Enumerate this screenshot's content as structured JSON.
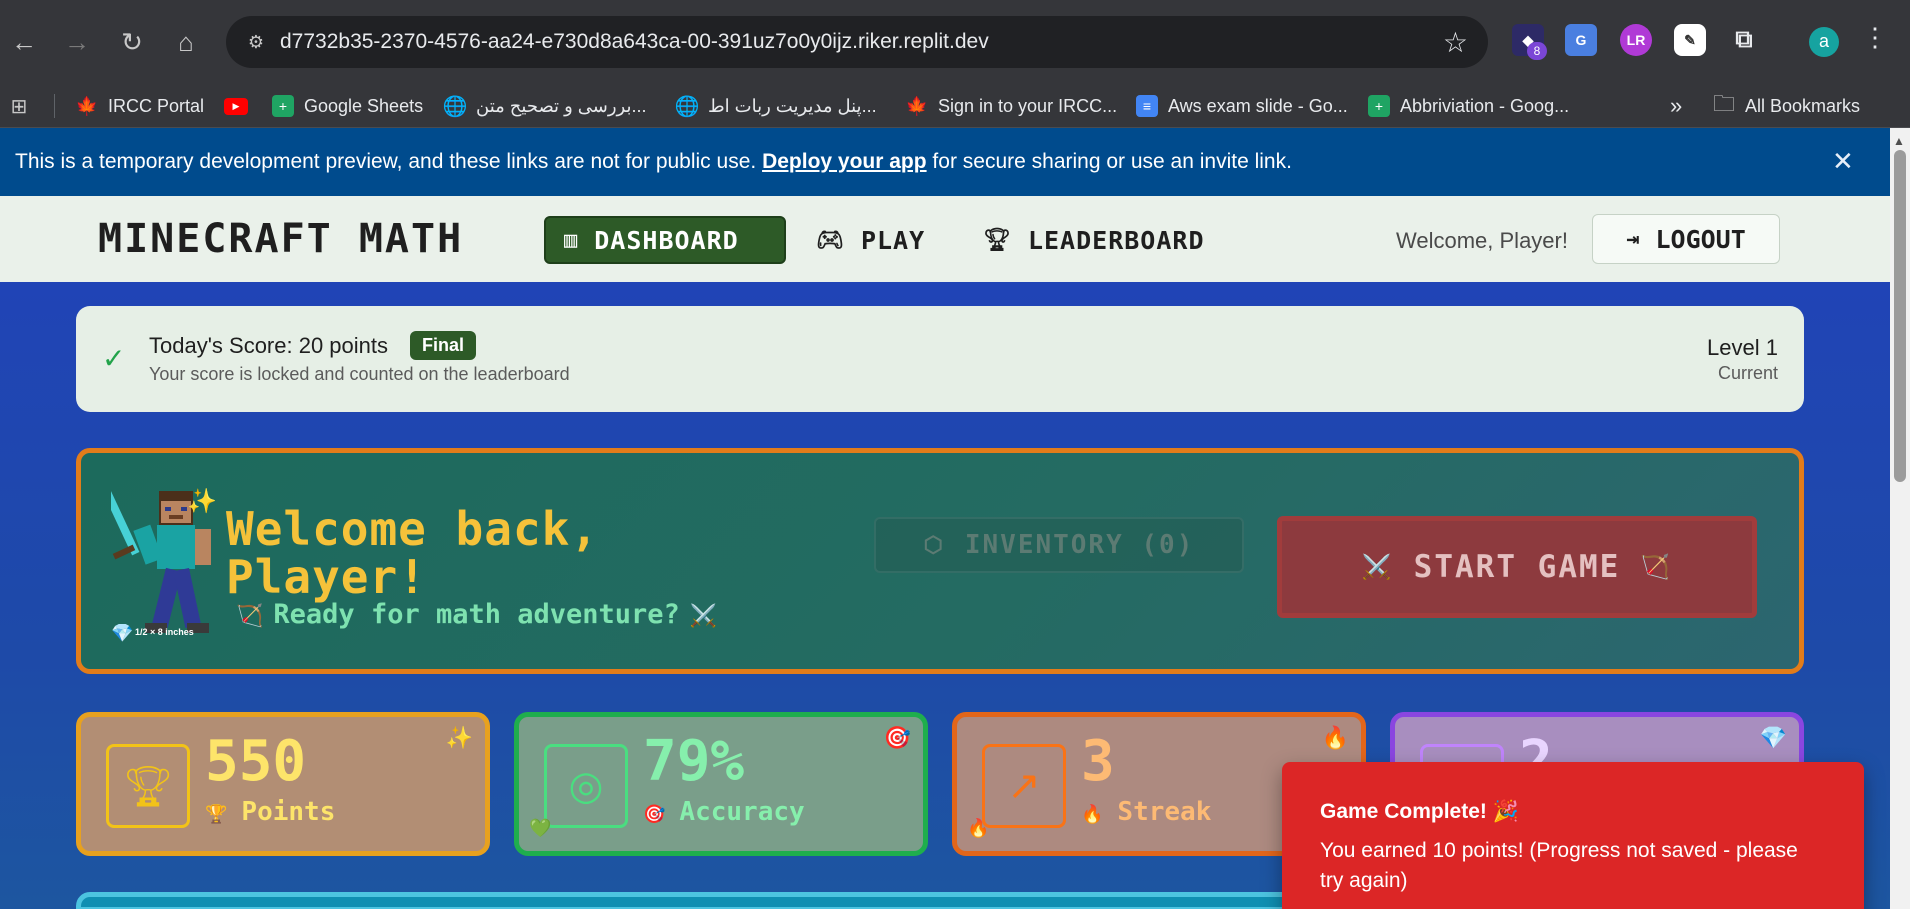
{
  "browser": {
    "url": "d7732b35-2370-4576-aa24-e730d8a643ca-00-391uz7o0y0ijz.riker.replit.dev",
    "extension_badge": "8",
    "profile_initial": "a",
    "bookmarks": [
      {
        "label": "IRCC Portal",
        "icon": "maple-leaf-icon"
      },
      {
        "label": "",
        "icon": "youtube-icon"
      },
      {
        "label": "Google Sheets",
        "icon": "sheets-icon"
      },
      {
        "label": "بررسی و تصحیح متن...",
        "icon": "globe-icon"
      },
      {
        "label": "پنل مدیریت ربات اط...",
        "icon": "globe-icon"
      },
      {
        "label": "Sign in to your IRCC...",
        "icon": "maple-leaf-icon"
      },
      {
        "label": "Aws exam slide - Go...",
        "icon": "docs-icon"
      },
      {
        "label": "Abbriviation - Goog...",
        "icon": "sheets-icon"
      }
    ],
    "more_bookmarks": "»",
    "all_bookmarks": "All Bookmarks"
  },
  "dev_banner": {
    "text_before": "This is a temporary development preview, and these links are not for public use. ",
    "link": "Deploy your app",
    "text_after": " for secure sharing or use an invite link.",
    "close": "✕"
  },
  "header": {
    "brand": "MINECRAFT MATH",
    "nav": [
      {
        "label": "DASHBOARD",
        "icon": "bar-chart-icon",
        "active": true
      },
      {
        "label": "PLAY",
        "icon": "gamepad-icon",
        "active": false
      },
      {
        "label": "LEADERBOARD",
        "icon": "trophy-icon",
        "active": false
      }
    ],
    "welcome": "Welcome, Player!",
    "logout": "LOGOUT"
  },
  "score": {
    "title": "Today's Score: 20 points",
    "badge": "Final",
    "subtitle": "Your score is locked and counted on the leaderboard",
    "level": "Level 1",
    "level_sub": "Current"
  },
  "hero": {
    "title": "Welcome back, Player!",
    "subtitle": "Ready for math adventure?",
    "tiny_caption": "1/2 × 8 inches",
    "inventory": "INVENTORY (0)",
    "start": "START GAME"
  },
  "stats": [
    {
      "value": "550",
      "label": "Points",
      "emoji": "🏆",
      "corner": "✨",
      "accent": "#e7a11f"
    },
    {
      "value": "79%",
      "label": "Accuracy",
      "emoji": "🎯",
      "corner": "🎯",
      "accent": "#1fae4d"
    },
    {
      "value": "3",
      "label": "Streak",
      "emoji": "🔥",
      "corner": "🔥",
      "accent": "#e2661a"
    },
    {
      "value": "2",
      "label": "",
      "emoji": "",
      "corner": "💎",
      "accent": "#8a46e0"
    }
  ],
  "toast": {
    "title": "Game Complete! 🎉",
    "body": "You earned 10 points! (Progress not saved - please try again)"
  },
  "colors": {
    "nav_active": "#2d5a27",
    "toast": "#dc2626",
    "banner": "#004b8d",
    "hero_border": "#e27c1a",
    "hero_title": "#f5c23a"
  }
}
